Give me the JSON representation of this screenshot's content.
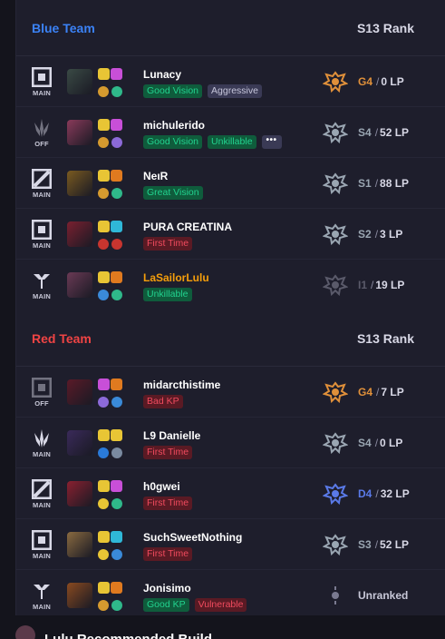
{
  "blue": {
    "team_title": "Blue Team",
    "rank_title": "S13 Rank",
    "players": [
      {
        "role": "MAIN",
        "role_icon": "top-lane-icon",
        "name": "Lunacy",
        "tags": [
          {
            "text": "Good Vision",
            "kind": "good"
          },
          {
            "text": "Aggressive",
            "kind": "neutral"
          }
        ],
        "tier": "G4",
        "lp": "0 LP",
        "tier_color": "#e0903a",
        "emblem": "gold-rank-emblem-icon",
        "champ_color": "#3a4a45",
        "spells": [
          "#e8c535",
          "#c84fd8"
        ],
        "runes": [
          "#d59a2f",
          "#2fb88a"
        ]
      },
      {
        "role": "OFF",
        "role_icon": "jungle-icon",
        "name": "michulerido",
        "tags": [
          {
            "text": "Good Vision",
            "kind": "good"
          },
          {
            "text": "Unkillable",
            "kind": "good"
          }
        ],
        "more": "•••",
        "tier": "S4",
        "lp": "52 LP",
        "tier_color": "#9aa6b2",
        "emblem": "silver-rank-emblem-icon",
        "champ_color": "#8a3a5a",
        "spells": [
          "#e8c535",
          "#c84fd8"
        ],
        "runes": [
          "#d59a2f",
          "#8c6ad8"
        ]
      },
      {
        "role": "MAIN",
        "role_icon": "mid-lane-icon",
        "name": "NeιR",
        "tags": [
          {
            "text": "Great Vision",
            "kind": "good"
          }
        ],
        "tier": "S1",
        "lp": "88 LP",
        "tier_color": "#9aa6b2",
        "emblem": "silver-rank-emblem-icon",
        "champ_color": "#7a5a20",
        "spells": [
          "#e8c535",
          "#e07a1f"
        ],
        "runes": [
          "#d59a2f",
          "#2fb88a"
        ]
      },
      {
        "role": "MAIN",
        "role_icon": "bot-lane-icon",
        "name": "PURA CREATINA",
        "tags": [
          {
            "text": "First Time",
            "kind": "bad"
          }
        ],
        "tier": "S2",
        "lp": "3 LP",
        "tier_color": "#9aa6b2",
        "emblem": "silver-rank-emblem-icon",
        "champ_color": "#7a2030",
        "spells": [
          "#e8c535",
          "#2fb8d8"
        ],
        "runes": [
          "#c7352f",
          "#c7352f"
        ]
      },
      {
        "role": "MAIN",
        "role_icon": "support-icon",
        "name": "LaSailorLulu",
        "highlight": true,
        "tags": [
          {
            "text": "Unkillable",
            "kind": "good"
          }
        ],
        "tier": "I1",
        "lp": "19 LP",
        "tier_color": "#5a5a6a",
        "emblem": "iron-rank-emblem-icon",
        "champ_color": "#6a3a55",
        "spells": [
          "#e8c535",
          "#e07a1f"
        ],
        "runes": [
          "#3a8ad8",
          "#2fb88a"
        ]
      }
    ]
  },
  "red": {
    "team_title": "Red Team",
    "rank_title": "S13 Rank",
    "players": [
      {
        "role": "OFF",
        "role_icon": "top-lane-icon",
        "name": "midarcthistime",
        "tags": [
          {
            "text": "Bad KP",
            "kind": "bad"
          }
        ],
        "tier": "G4",
        "lp": "7 LP",
        "tier_color": "#e0903a",
        "emblem": "gold-rank-emblem-icon",
        "champ_color": "#5a1a28",
        "spells": [
          "#c84fd8",
          "#e07a1f"
        ],
        "runes": [
          "#8c6ad8",
          "#3a8ad8"
        ]
      },
      {
        "role": "MAIN",
        "role_icon": "jungle-icon",
        "name": "L9 Danielle",
        "tags": [
          {
            "text": "First Time",
            "kind": "bad"
          }
        ],
        "tier": "S4",
        "lp": "0 LP",
        "tier_color": "#9aa6b2",
        "emblem": "silver-rank-emblem-icon",
        "champ_color": "#3a2a5a",
        "spells": [
          "#e8c535",
          "#e8c535"
        ],
        "runes": [
          "#2a7ad8",
          "#7a8aa0"
        ]
      },
      {
        "role": "MAIN",
        "role_icon": "mid-lane-icon",
        "name": "h0gwei",
        "tags": [
          {
            "text": "First Time",
            "kind": "bad"
          }
        ],
        "tier": "D4",
        "lp": "32 LP",
        "tier_color": "#5a7ae8",
        "emblem": "diamond-rank-emblem-icon",
        "champ_color": "#8a2030",
        "spells": [
          "#e8c535",
          "#c84fd8"
        ],
        "runes": [
          "#e8c535",
          "#2fb88a"
        ]
      },
      {
        "role": "MAIN",
        "role_icon": "bot-lane-icon",
        "name": "SuchSweetNothing",
        "tags": [
          {
            "text": "First Time",
            "kind": "bad"
          }
        ],
        "tier": "S3",
        "lp": "52 LP",
        "tier_color": "#9aa6b2",
        "emblem": "silver-rank-emblem-icon",
        "champ_color": "#8a6a40",
        "spells": [
          "#e8c535",
          "#2fb8d8"
        ],
        "runes": [
          "#e8c535",
          "#3a8ad8"
        ]
      },
      {
        "role": "MAIN",
        "role_icon": "support-icon",
        "name": "Jonisimo",
        "tags": [
          {
            "text": "Good KP",
            "kind": "good"
          },
          {
            "text": "Vulnerable",
            "kind": "bad"
          }
        ],
        "unranked": "Unranked",
        "tier_color": "#7a7a90",
        "emblem": "unranked-emblem-icon",
        "champ_color": "#8a4a20",
        "spells": [
          "#e8c535",
          "#e07a1f"
        ],
        "runes": [
          "#d59a2f",
          "#2fb88a"
        ]
      }
    ]
  },
  "recommended": {
    "title": "Lulu Recommended Build"
  }
}
